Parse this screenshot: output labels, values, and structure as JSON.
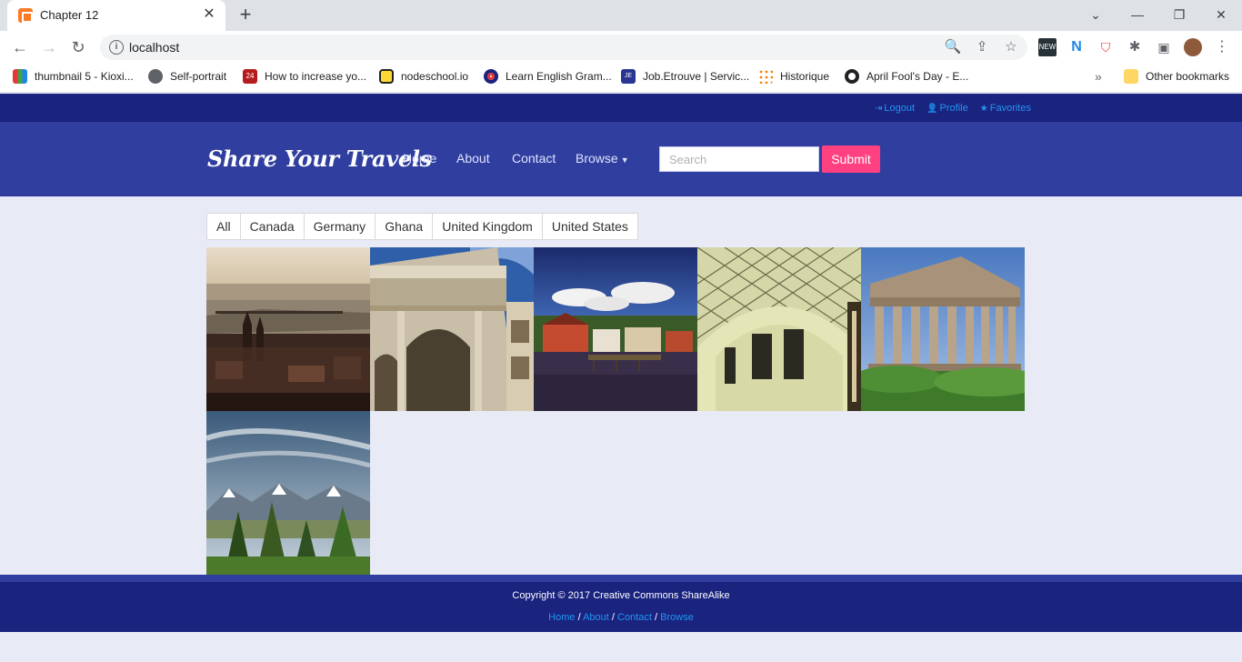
{
  "browser": {
    "tab_title": "Chapter 12",
    "url": "localhost",
    "bookmarks": [
      {
        "label": "thumbnail 5 - Kioxi...",
        "color": "#e53935"
      },
      {
        "label": "Self-portrait",
        "color": "#5f6368"
      },
      {
        "label": "How to increase yo...",
        "color": "#b71c1c"
      },
      {
        "label": "nodeschool.io",
        "color": "#fdd835"
      },
      {
        "label": "Learn English Gram...",
        "color": "#1a237e"
      },
      {
        "label": "Job.Etrouve | Servic...",
        "color": "#283593"
      },
      {
        "label": "Historique",
        "color": "#f57c00"
      },
      {
        "label": "April Fool's Day - E...",
        "color": "#202124"
      }
    ],
    "other_bookmarks": "Other bookmarks"
  },
  "topbar": {
    "logout": "Logout",
    "profile": "Profile",
    "favorites": "Favorites"
  },
  "nav": {
    "brand": "Share Your Travels",
    "links": [
      "Home",
      "About",
      "Contact",
      "Browse"
    ],
    "search_placeholder": "Search",
    "submit_label": "Submit"
  },
  "filters": [
    "All",
    "Canada",
    "Germany",
    "Ghana",
    "United Kingdom",
    "United States"
  ],
  "photos": [
    {
      "name": "photo-city-river-bridge"
    },
    {
      "name": "photo-roman-triumphal-arch"
    },
    {
      "name": "photo-harbor-town"
    },
    {
      "name": "photo-museum-glass-roof"
    },
    {
      "name": "photo-greek-temple"
    },
    {
      "name": "photo-mountain-valley"
    }
  ],
  "footer": {
    "copyright": "Copyright © 2017 Creative Commons ShareAlike",
    "links": [
      "Home",
      "About",
      "Contact",
      "Browse"
    ],
    "separator": "/"
  },
  "colors": {
    "topbar": "#1a237e",
    "navbar": "#303f9f",
    "accent": "#ff4081",
    "link": "#2196f3",
    "page_bg": "#e8eaf6"
  }
}
